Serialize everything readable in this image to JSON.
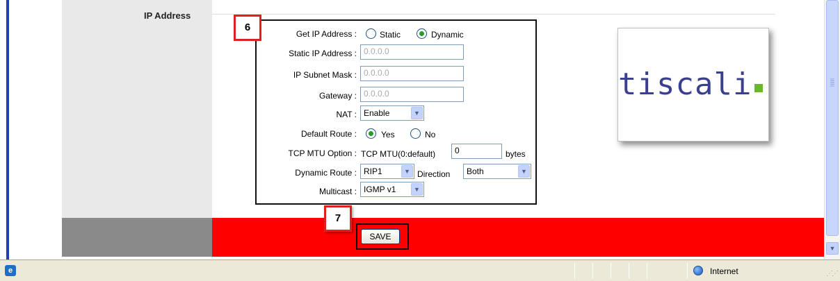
{
  "section": {
    "label": "IP Address"
  },
  "callouts": {
    "form": "6",
    "save": "7"
  },
  "form": {
    "get_ip": {
      "label": "Get IP Address :",
      "options": [
        "Static",
        "Dynamic"
      ],
      "selected": "Dynamic"
    },
    "static_ip": {
      "label": "Static IP Address :",
      "value": "0.0.0.0"
    },
    "subnet": {
      "label": "IP Subnet Mask :",
      "value": "0.0.0.0"
    },
    "gateway": {
      "label": "Gateway :",
      "value": "0.0.0.0"
    },
    "nat": {
      "label": "NAT :",
      "value": "Enable"
    },
    "default_route": {
      "label": "Default Route :",
      "options": [
        "Yes",
        "No"
      ],
      "selected": "Yes"
    },
    "tcp_mtu": {
      "label": "TCP MTU Option :",
      "prefix": "TCP MTU(0:default)",
      "value": "0",
      "unit": "bytes"
    },
    "dynamic_route": {
      "label": "Dynamic Route :",
      "value": "RIP1",
      "direction_label": "Direction",
      "direction_value": "Both"
    },
    "multicast": {
      "label": "Multicast :",
      "value": "IGMP v1"
    }
  },
  "logo": {
    "text": "tiscali",
    "dot_color": "#6ab72c",
    "text_color": "#3b3f8f"
  },
  "save_button": {
    "label": "SAVE"
  },
  "statusbar": {
    "zone": "Internet",
    "page_icon": "ie-page-icon",
    "zone_icon": "globe-icon"
  },
  "colors": {
    "footer_red": "#ff0000",
    "callout_border": "#e01f1f"
  }
}
